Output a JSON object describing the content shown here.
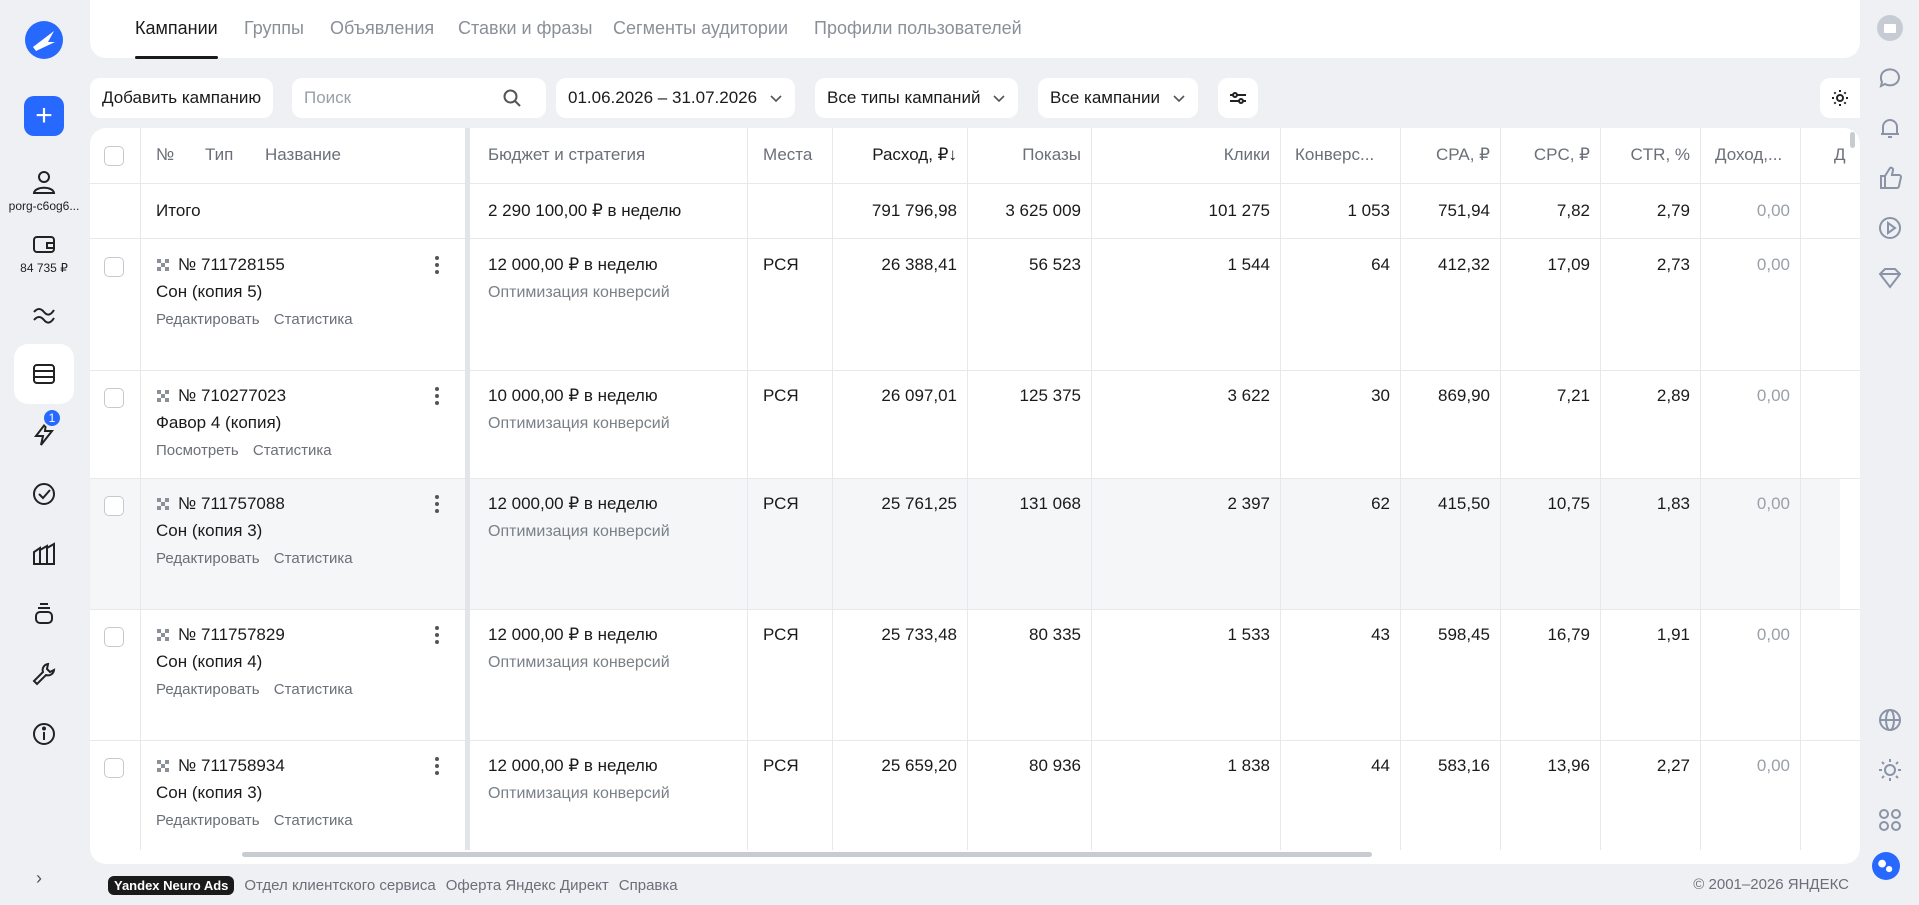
{
  "sidebar": {
    "account_name": "porg-c6og6...",
    "balance": "84 735 ₽",
    "notification_count": "1"
  },
  "tabs": [
    {
      "label": "Кампании"
    },
    {
      "label": "Группы"
    },
    {
      "label": "Объявления"
    },
    {
      "label": "Ставки и фразы"
    },
    {
      "label": "Сегменты аудитории"
    },
    {
      "label": "Профили пользователей"
    }
  ],
  "toolbar": {
    "add_campaign": "Добавить кампанию",
    "search_placeholder": "Поиск",
    "date_range": "01.06.2026 – 31.07.2026",
    "campaign_types": "Все типы кампаний",
    "campaign_filter": "Все кампании"
  },
  "table": {
    "headers": {
      "num": "№",
      "type": "Тип",
      "name": "Название",
      "budget": "Бюджет и стратегия",
      "places": "Места",
      "spend": "Расход, ₽↓",
      "impressions": "Показы",
      "clicks": "Клики",
      "conversions": "Конверс...",
      "cpa": "CPA, ₽",
      "cpc": "CPC, ₽",
      "ctr": "CTR, %",
      "revenue": "Доход,...",
      "extra": "Д"
    },
    "total": {
      "label": "Итого",
      "budget": "2 290 100,00 ₽ в неделю",
      "spend": "791 796,98",
      "impressions": "3 625 009",
      "clicks": "101 275",
      "conversions": "1 053",
      "cpa": "751,94",
      "cpc": "7,82",
      "ctr": "2,79",
      "revenue": "0,00"
    },
    "rows": [
      {
        "id": "№ 711728155",
        "name": "Сон (копия 5)",
        "link1": "Редактировать",
        "link2": "Статистика",
        "budget": "12 000,00 ₽ в неделю",
        "strategy": "Оптимизация конверсий",
        "places": "РСЯ",
        "spend": "26 388,41",
        "impressions": "56 523",
        "clicks": "1 544",
        "conversions": "64",
        "cpa": "412,32",
        "cpc": "17,09",
        "ctr": "2,73",
        "revenue": "0,00"
      },
      {
        "id": "№ 710277023",
        "name": "Фавор 4 (копия)",
        "link1": "Посмотреть",
        "link2": "Статистика",
        "budget": "10 000,00 ₽ в неделю",
        "strategy": "Оптимизация конверсий",
        "places": "РСЯ",
        "spend": "26 097,01",
        "impressions": "125 375",
        "clicks": "3 622",
        "conversions": "30",
        "cpa": "869,90",
        "cpc": "7,21",
        "ctr": "2,89",
        "revenue": "0,00"
      },
      {
        "id": "№ 711757088",
        "name": "Сон (копия 3)",
        "link1": "Редактировать",
        "link2": "Статистика",
        "budget": "12 000,00 ₽ в неделю",
        "strategy": "Оптимизация конверсий",
        "places": "РСЯ",
        "spend": "25 761,25",
        "impressions": "131 068",
        "clicks": "2 397",
        "conversions": "62",
        "cpa": "415,50",
        "cpc": "10,75",
        "ctr": "1,83",
        "revenue": "0,00"
      },
      {
        "id": "№ 711757829",
        "name": "Сон (копия 4)",
        "link1": "Редактировать",
        "link2": "Статистика",
        "budget": "12 000,00 ₽ в неделю",
        "strategy": "Оптимизация конверсий",
        "places": "РСЯ",
        "spend": "25 733,48",
        "impressions": "80 335",
        "clicks": "1 533",
        "conversions": "43",
        "cpa": "598,45",
        "cpc": "16,79",
        "ctr": "1,91",
        "revenue": "0,00"
      },
      {
        "id": "№ 711758934",
        "name": "Сон (копия 3)",
        "link1": "Редактировать",
        "link2": "Статистика",
        "budget": "12 000,00 ₽ в неделю",
        "strategy": "Оптимизация конверсий",
        "places": "РСЯ",
        "spend": "25 659,20",
        "impressions": "80 936",
        "clicks": "1 838",
        "conversions": "44",
        "cpa": "583,16",
        "cpc": "13,96",
        "ctr": "2,27",
        "revenue": "0,00"
      }
    ]
  },
  "footer": {
    "badge": "Yandex Neuro Ads",
    "link1": "Отдел клиентского сервиса",
    "link2": "Оферта Яндекс Директ",
    "link3": "Справка",
    "copyright": "© 2001–2026 ЯНДЕКС"
  }
}
